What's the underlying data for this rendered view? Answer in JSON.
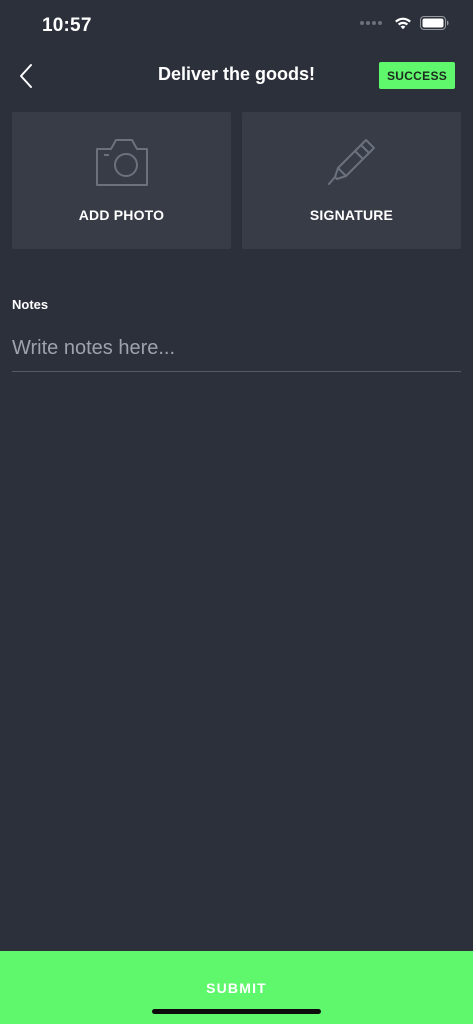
{
  "status_bar": {
    "time": "10:57",
    "icons": [
      "cellular-signal-icon",
      "wifi-icon",
      "battery-icon"
    ]
  },
  "header": {
    "title": "Deliver the goods!",
    "back_icon": "chevron-left-icon",
    "status_badge": "SUCCESS"
  },
  "tiles": [
    {
      "label": "ADD PHOTO",
      "icon": "camera-icon"
    },
    {
      "label": "SIGNATURE",
      "icon": "pen-icon"
    }
  ],
  "notes": {
    "label": "Notes",
    "placeholder": "Write notes here...",
    "value": ""
  },
  "submit": {
    "label": "SUBMIT"
  },
  "colors": {
    "background": "#2b303b",
    "tile": "#373c47",
    "accent": "#5ff86c",
    "text": "#ffffff",
    "placeholder": "#9ea2ab"
  }
}
